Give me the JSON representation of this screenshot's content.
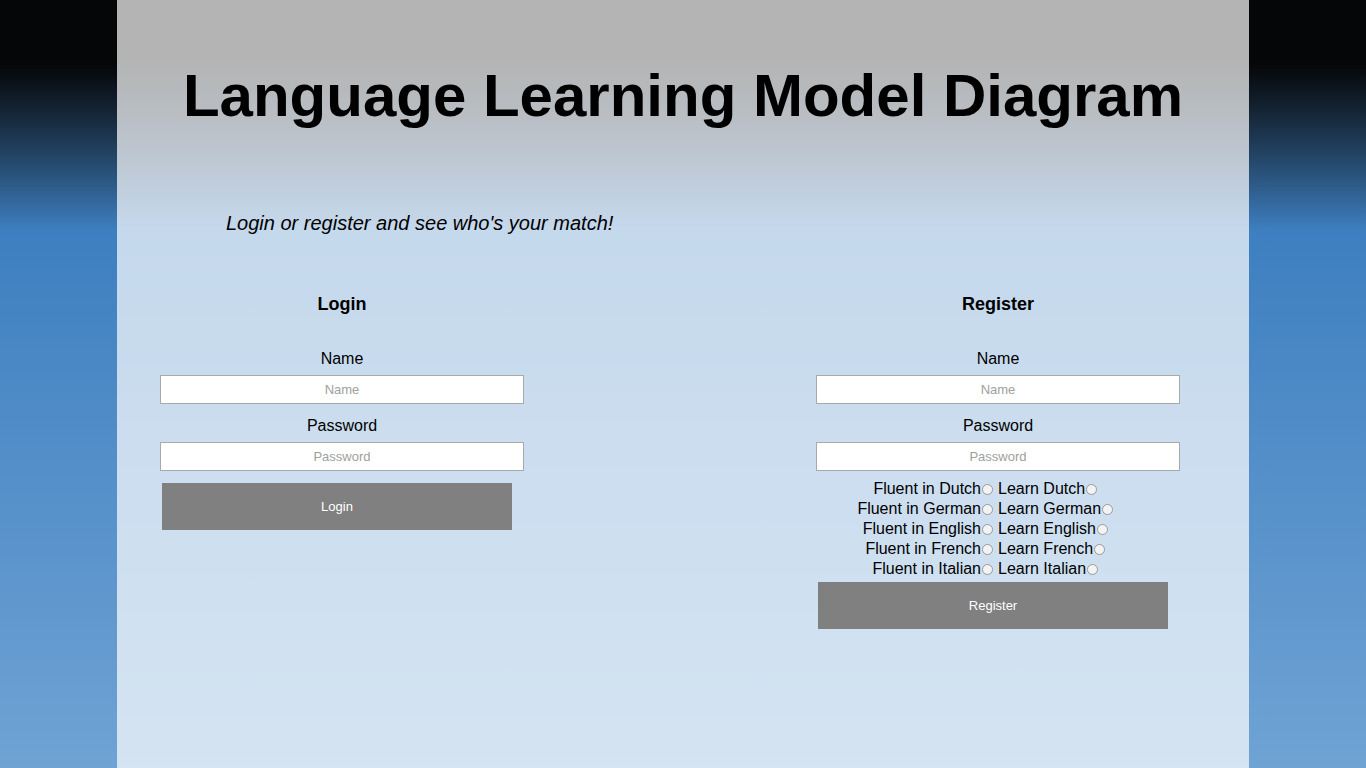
{
  "title": "Language Learning Model Diagram",
  "subtitle": "Login or register and see who's your match!",
  "login": {
    "heading": "Login",
    "fields": [
      {
        "label": "Name",
        "placeholder": "Name"
      },
      {
        "label": "Password",
        "placeholder": "Password"
      }
    ],
    "button": "Login"
  },
  "register": {
    "heading": "Register",
    "fields": [
      {
        "label": "Name",
        "placeholder": "Name"
      },
      {
        "label": "Password",
        "placeholder": "Password"
      }
    ],
    "languages": [
      {
        "fluent": {
          "label": "Fluent in Dutch",
          "selected": false
        },
        "learn": {
          "label": "Learn Dutch",
          "selected": false
        }
      },
      {
        "fluent": {
          "label": "Fluent in German",
          "selected": false
        },
        "learn": {
          "label": "Learn German",
          "selected": false
        }
      },
      {
        "fluent": {
          "label": "Fluent in English",
          "selected": false
        },
        "learn": {
          "label": "Learn English",
          "selected": false
        }
      },
      {
        "fluent": {
          "label": "Fluent in French",
          "selected": false
        },
        "learn": {
          "label": "Learn French",
          "selected": false
        }
      },
      {
        "fluent": {
          "label": "Fluent in Italian",
          "selected": false
        },
        "learn": {
          "label": "Learn Italian",
          "selected": false
        }
      }
    ],
    "button": "Register"
  }
}
